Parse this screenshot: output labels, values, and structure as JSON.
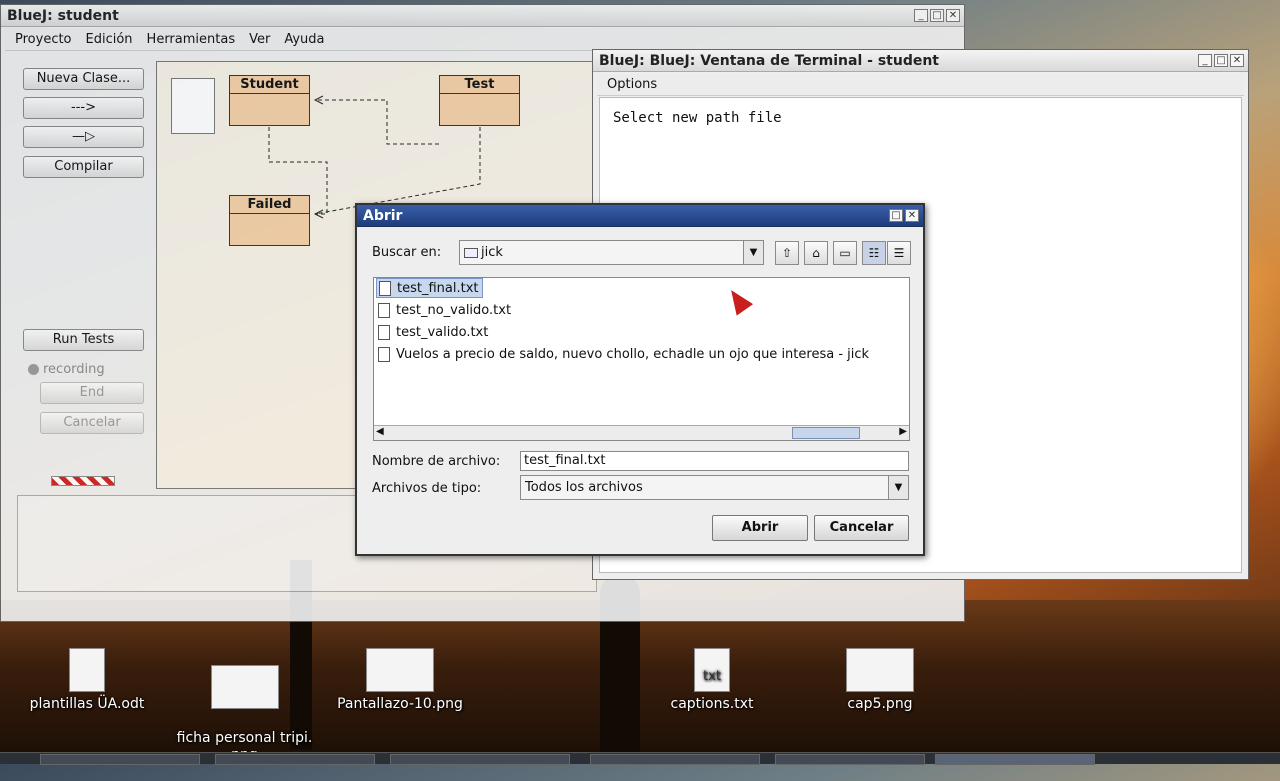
{
  "desktop": {
    "icons": [
      {
        "label": "plantillas ÜA.odt"
      },
      {
        "label": "ficha personal tripi.\npng"
      },
      {
        "label": "Pantallazo-10.png"
      },
      {
        "label": "captions.txt",
        "glyph": "txt"
      },
      {
        "label": "cap5.png"
      }
    ]
  },
  "bluej_main": {
    "title": "BlueJ:  student",
    "menu": [
      "Proyecto",
      "Edición",
      "Herramientas",
      "Ver",
      "Ayuda"
    ],
    "buttons": {
      "new_class": "Nueva Clase...",
      "dependency_arrow": "--->",
      "inherit_arrow": "—▷",
      "compile": "Compilar",
      "run_tests": "Run Tests",
      "end": "End",
      "cancel": "Cancelar"
    },
    "recording_label": "recording",
    "classes": [
      "Student",
      "Test",
      "Failed"
    ]
  },
  "terminal": {
    "title": "BlueJ: BlueJ:  Ventana de Terminal - student",
    "menu_options": "Options",
    "output": "Select new path file"
  },
  "dialog": {
    "title": "Abrir",
    "look_in_label": "Buscar en:",
    "look_in_value": "jick",
    "files": [
      {
        "name": "test_final.txt",
        "selected": true
      },
      {
        "name": "test_no_valido.txt",
        "selected": false
      },
      {
        "name": "test_valido.txt",
        "selected": false
      },
      {
        "name": "Vuelos a precio de saldo, nuevo chollo, echadle un ojo que interesa - jick",
        "selected": false
      }
    ],
    "filename_label": "Nombre de archivo:",
    "filename_value": "test_final.txt",
    "filetype_label": "Archivos de tipo:",
    "filetype_value": "Todos los archivos",
    "open_button": "Abrir",
    "cancel_button": "Cancelar"
  }
}
